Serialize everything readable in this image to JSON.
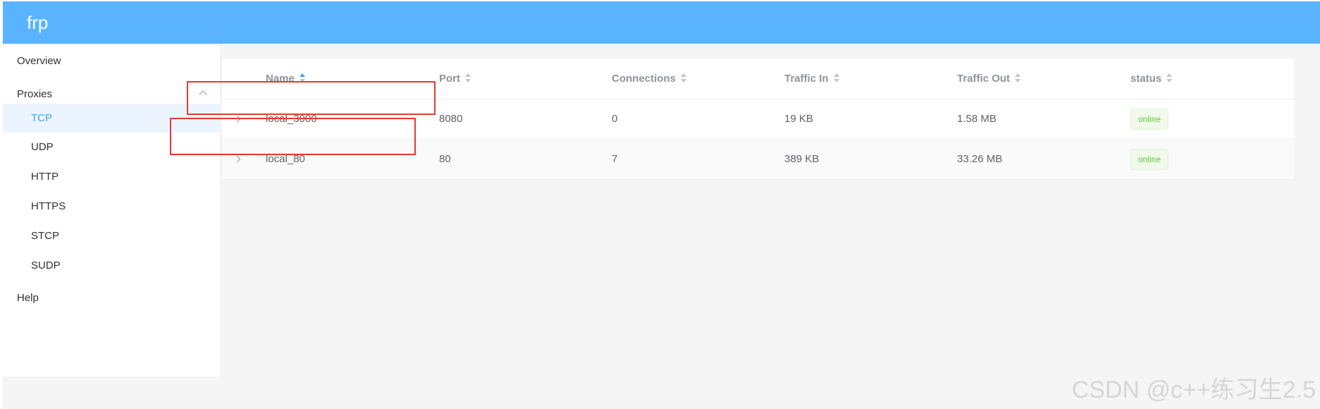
{
  "app": {
    "brand": "frp"
  },
  "sidebar": {
    "items": [
      {
        "label": "Overview"
      },
      {
        "label": "Proxies"
      },
      {
        "label": "TCP"
      },
      {
        "label": "UDP"
      },
      {
        "label": "HTTP"
      },
      {
        "label": "HTTPS"
      },
      {
        "label": "STCP"
      },
      {
        "label": "SUDP"
      },
      {
        "label": "Help"
      }
    ],
    "active": "TCP",
    "expanded": "Proxies"
  },
  "table": {
    "columns": [
      "Name",
      "Port",
      "Connections",
      "Traffic In",
      "Traffic Out",
      "status"
    ],
    "sort": {
      "column": "Name",
      "direction": "ascending"
    },
    "rows": [
      {
        "name": "local_3000",
        "port": "8080",
        "connections": "0",
        "traffic_in": "19 KB",
        "traffic_out": "1.58 MB",
        "status": "online"
      },
      {
        "name": "local_80",
        "port": "80",
        "connections": "7",
        "traffic_in": "389 KB",
        "traffic_out": "33.26 MB",
        "status": "online"
      }
    ]
  },
  "annotation": {
    "color": "#e53935"
  },
  "colors": {
    "header": "#5ab3ff",
    "accent": "#409eff",
    "online": "#67c23a"
  },
  "watermark": "CSDN @c++练习生2.5"
}
